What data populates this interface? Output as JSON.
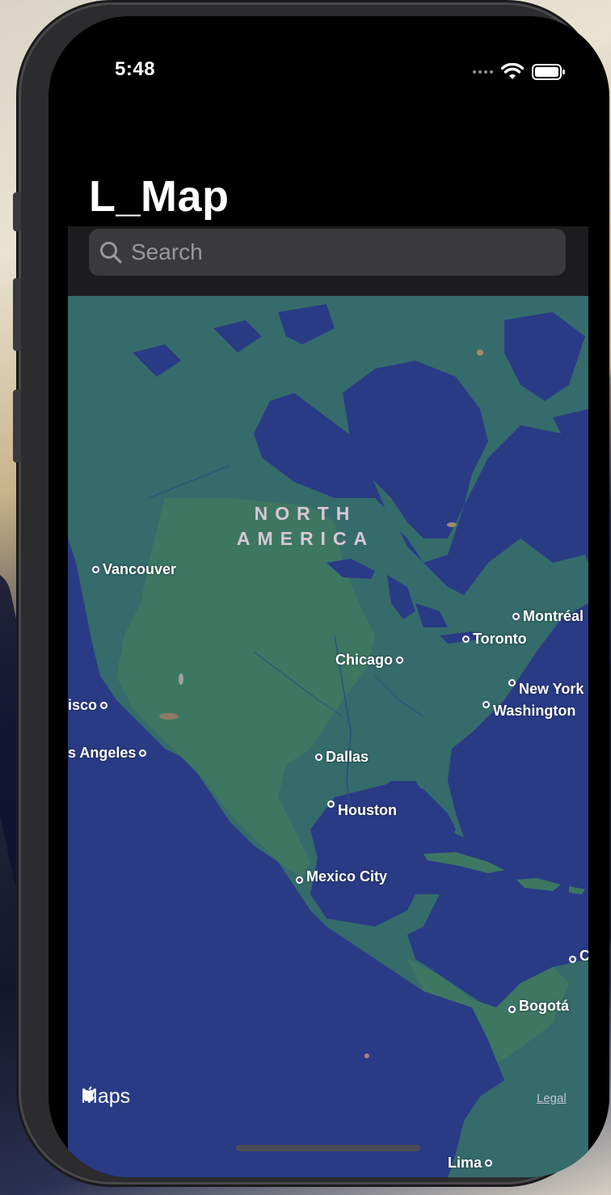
{
  "status_bar": {
    "time": "5:48"
  },
  "nav": {
    "title": "L_Map"
  },
  "search": {
    "placeholder": "Search"
  },
  "map": {
    "continent_label": {
      "line1": "NORTH",
      "line2": "AMERICA"
    },
    "cities": [
      "Vancouver",
      "Montréal",
      "Toronto",
      "Chicago",
      "New York",
      "Washington",
      "isco",
      "s Angeles",
      "Dallas",
      "Houston",
      "Mexico City",
      "Bogotá",
      "C",
      "Lima"
    ],
    "attribution": {
      "logo_text": "Maps",
      "legal": "Legal"
    },
    "colors": {
      "ocean": "#2a3b86",
      "land": "#356b6b",
      "land_light": "#3f7a66"
    }
  }
}
